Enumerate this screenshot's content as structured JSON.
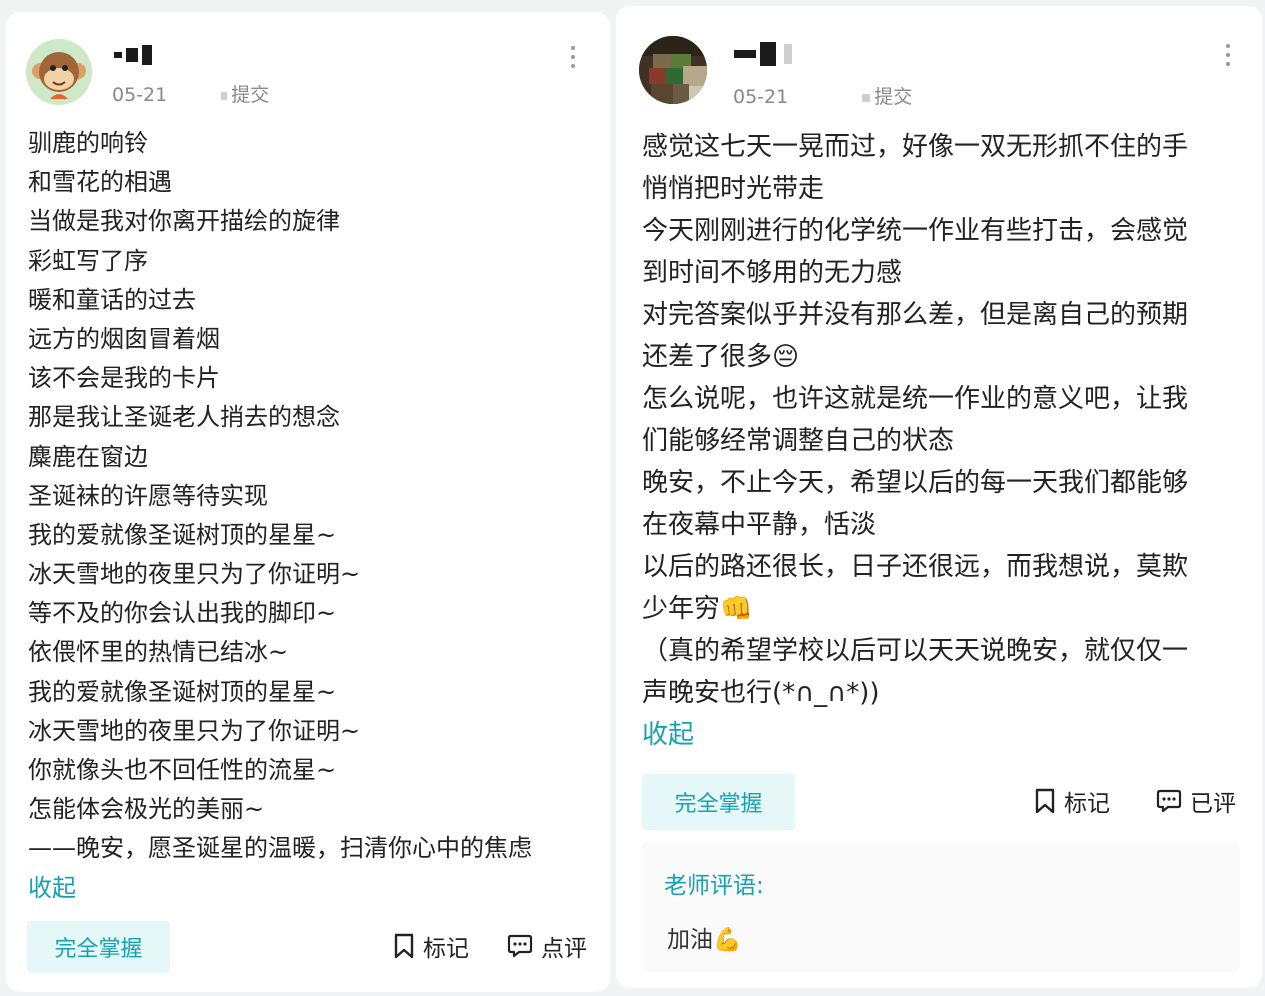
{
  "left_card": {
    "date": "05-21",
    "submit_label": "提交",
    "lines": [
      "驯鹿的响铃",
      "和雪花的相遇",
      "当做是我对你离开描绘的旋律",
      "彩虹写了序",
      "暖和童话的过去",
      "远方的烟囱冒着烟",
      "该不会是我的卡片",
      "那是我让圣诞老人捎去的想念",
      "麋鹿在窗边",
      "圣诞袜的许愿等待实现",
      "我的爱就像圣诞树顶的星星~",
      "冰天雪地的夜里只为了你证明~",
      "等不及的你会认出我的脚印~",
      "依偎怀里的热情已结冰~",
      "我的爱就像圣诞树顶的星星~",
      "冰天雪地的夜里只为了你证明~",
      "你就像头也不回任性的流星~",
      "怎能体会极光的美丽~",
      "——晚安，愿圣诞星的温暖，扫清你心中的焦虑"
    ],
    "collapse_label": "收起",
    "master_label": "完全掌握",
    "mark_label": "标记",
    "review_label": "点评"
  },
  "right_card": {
    "date": "05-21",
    "submit_label": "提交",
    "lines": [
      "感觉这七天一晃而过，好像一双无形抓不住的手",
      "悄悄把时光带走",
      "今天刚刚进行的化学统一作业有些打击，会感觉",
      "到时间不够用的无力感",
      "对完答案似乎并没有那么差，但是离自己的预期",
      "还差了很多😔",
      "怎么说呢，也许这就是统一作业的意义吧，让我",
      "们能够经常调整自己的状态",
      "晚安，不止今天，希望以后的每一天我们都能够",
      "在夜幕中平静，恬淡",
      "以后的路还很长，日子还很远，而我想说，莫欺",
      "少年穷👊",
      "（真的希望学校以后可以天天说晚安，就仅仅一",
      "声晚安也行(*∩_∩*))"
    ],
    "collapse_label": "收起",
    "master_label": "完全掌握",
    "mark_label": "标记",
    "review_label": "已评",
    "teacher_comment_label": "老师评语:",
    "teacher_comment_text": "加油💪"
  },
  "colors": {
    "accent": "#17a2b3",
    "button_bg": "#e6f7f7",
    "meta_text": "#888888"
  },
  "icons": [
    "monkey-avatar-icon",
    "more-vertical-icon",
    "bookmark-icon",
    "comment-icon"
  ]
}
